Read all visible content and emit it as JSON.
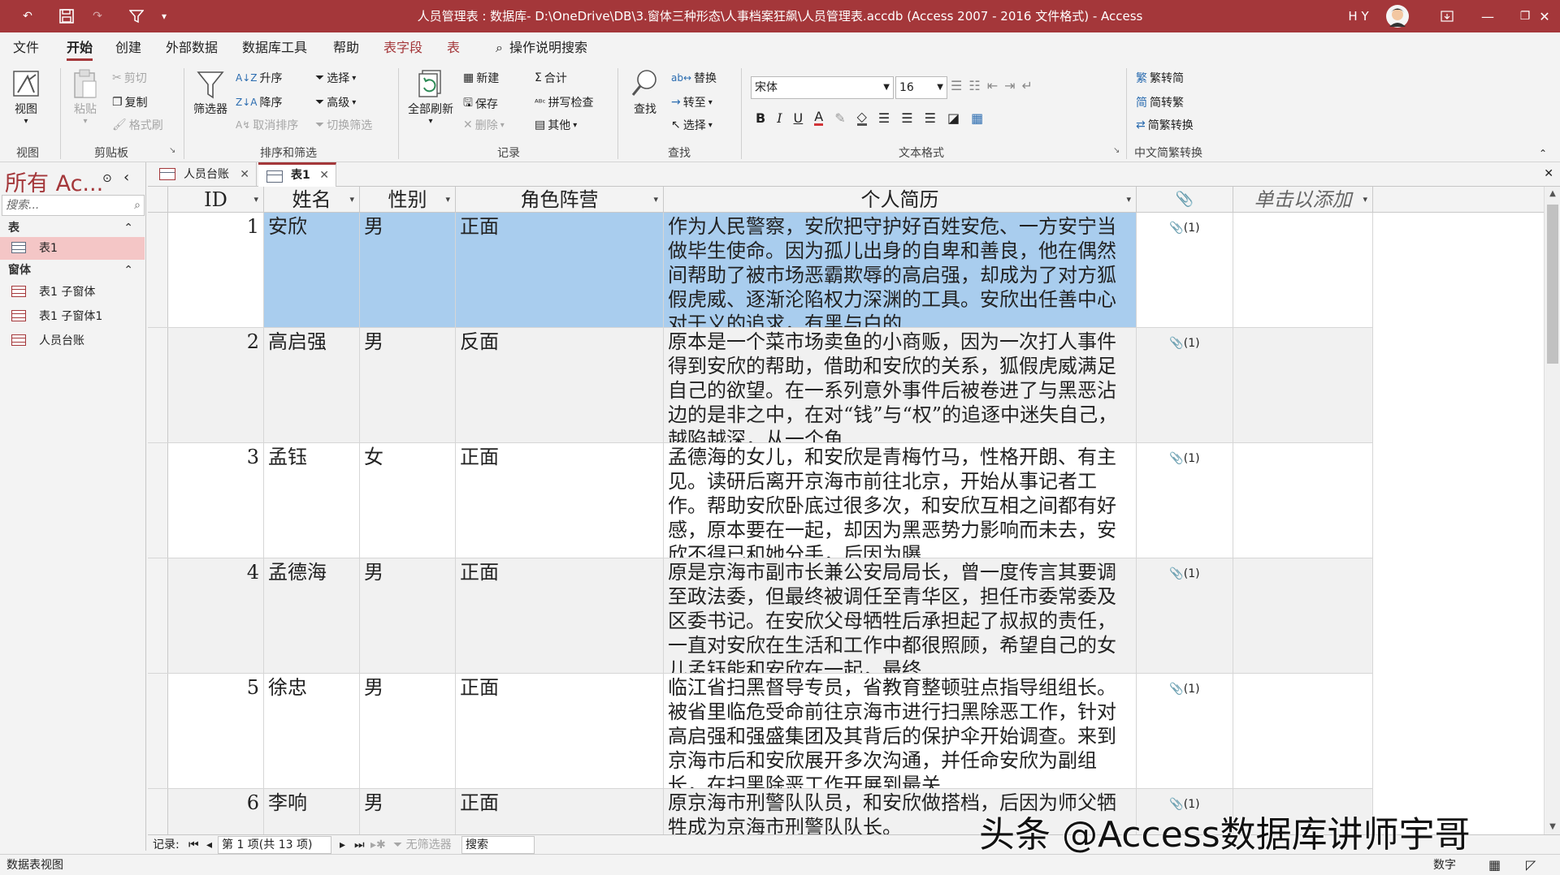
{
  "title_bar": {
    "title": "人员管理表 : 数据库- D:\\OneDrive\\DB\\3.窗体三种形态\\人事档案狂飙\\人员管理表.accdb (Access 2007 - 2016 文件格式)  -  Access",
    "user_initials": "H Y"
  },
  "menu": {
    "tabs": [
      "文件",
      "开始",
      "创建",
      "外部数据",
      "数据库工具",
      "帮助",
      "表字段",
      "表"
    ],
    "active_tab": "开始",
    "search_label": "操作说明搜索"
  },
  "ribbon": {
    "view": {
      "label": "视图",
      "group": "视图"
    },
    "clipboard": {
      "paste": "粘贴",
      "cut": "剪切",
      "copy": "复制",
      "format_painter": "格式刷",
      "group": "剪贴板"
    },
    "sort_filter": {
      "filter": "筛选器",
      "ascending": "升序",
      "descending": "降序",
      "remove_sort": "取消排序",
      "selection": "选择",
      "advanced": "高级",
      "toggle_filter": "切换筛选",
      "group": "排序和筛选"
    },
    "records": {
      "refresh_all": "全部刷新",
      "new": "新建",
      "save": "保存",
      "delete": "删除",
      "totals": "合计",
      "spelling": "拼写检查",
      "more": "其他",
      "group": "记录"
    },
    "find": {
      "find": "查找",
      "replace": "替换",
      "goto": "转至",
      "select": "选择",
      "group": "查找"
    },
    "text_format": {
      "font": "宋体",
      "size": "16",
      "group": "文本格式"
    },
    "chinese_conv": {
      "to_simplified": "繁转简",
      "to_traditional": "简转繁",
      "conversion": "简繁转换",
      "group": "中文简繁转换"
    }
  },
  "nav_pane": {
    "header": "所有 Ac...",
    "search_placeholder": "搜索...",
    "sections": [
      {
        "title": "表",
        "items": [
          "表1"
        ]
      },
      {
        "title": "窗体",
        "items": [
          "表1 子窗体",
          "表1 子窗体1",
          "人员台账"
        ]
      }
    ],
    "selected": "表1"
  },
  "doc_tabs": [
    {
      "label": "人员台账",
      "active": false
    },
    {
      "label": "表1",
      "active": true
    }
  ],
  "datasheet": {
    "columns": [
      "ID",
      "姓名",
      "性别",
      "角色阵营",
      "个人简历",
      "",
      "单击以添加"
    ],
    "attachment_header_icon": "paperclip-icon",
    "rows": [
      {
        "id": "1",
        "name": "安欣",
        "gender": "男",
        "camp": "正面",
        "resume": "作为人民警察，安欣把守护好百姓安危、一方安宁当做毕生使命。因为孤儿出身的自卑和善良，他在偶然间帮助了被市场恶霸欺辱的高启强，却成为了对方狐假虎威、逐渐沦陷权力深渊的工具。安欣出任善中心对于义的追求，有黑与白的",
        "attachment": "(1)"
      },
      {
        "id": "2",
        "name": "高启强",
        "gender": "男",
        "camp": "反面",
        "resume": "原本是一个菜市场卖鱼的小商贩，因为一次打人事件得到安欣的帮助，借助和安欣的关系，狐假虎威满足自己的欲望。在一系列意外事件后被卷进了与黑恶沾边的是非之中，在对“钱”与“权”的追逐中迷失自己，越陷越深，从一个鱼",
        "attachment": "(1)"
      },
      {
        "id": "3",
        "name": "孟钰",
        "gender": "女",
        "camp": "正面",
        "resume": "孟德海的女儿，和安欣是青梅竹马，性格开朗、有主见。读研后离开京海市前往北京，开始从事记者工作。帮助安欣卧底过很多次，和安欣互相之间都有好感，原本要在一起，却因为黑恶势力影响而未去，安欣不得已和她分手，后因为曝",
        "attachment": "(1)"
      },
      {
        "id": "4",
        "name": "孟德海",
        "gender": "男",
        "camp": "正面",
        "resume": "原是京海市副市长兼公安局局长，曾一度传言其要调至政法委，但最终被调任至青华区，担任市委常委及区委书记。在安欣父母牺牲后承担起了叔叔的责任，一直对安欣在生活和工作中都很照顾，希望自己的女儿孟钰能和安欣在一起，最终",
        "attachment": "(1)"
      },
      {
        "id": "5",
        "name": "徐忠",
        "gender": "男",
        "camp": "正面",
        "resume": "临江省扫黑督导专员，省教育整顿驻点指导组组长。被省里临危受命前往京海市进行扫黑除恶工作，针对高启强和强盛集团及其背后的保护伞开始调查。来到京海市后和安欣展开多次沟通，并任命安欣为副组长，在扫黑除恶工作开展到最关",
        "attachment": "(1)"
      },
      {
        "id": "6",
        "name": "李响",
        "gender": "男",
        "camp": "正面",
        "resume": "原京海市刑警队队员，和安欣做搭档，后因为师父牺牲成为京海市刑警队队长。",
        "attachment": "(1)"
      }
    ]
  },
  "record_nav": {
    "label": "记录:",
    "position": "第 1 项(共 13 项)",
    "no_filter": "无筛选器",
    "search": "搜索"
  },
  "status_bar": {
    "left": "数据表视图",
    "numlock": "数字"
  },
  "watermark": "头条 @Access数据库讲师宇哥",
  "colors": {
    "accent": "#a4373a",
    "selection": "#a9cdee",
    "nav_selected": "#f4c6c6"
  }
}
